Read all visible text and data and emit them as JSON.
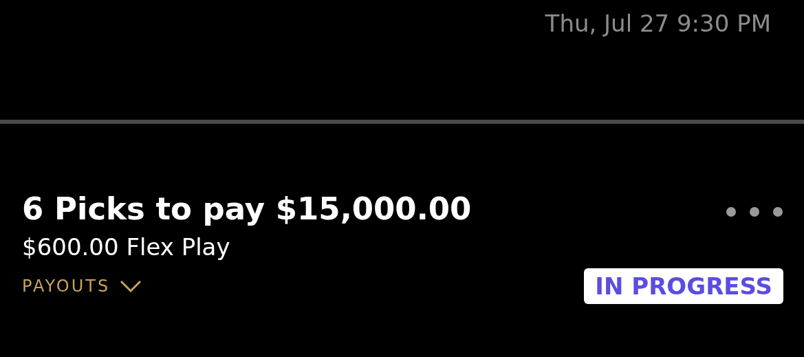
{
  "header": {
    "date": "Thu, Jul 27 9:30 PM"
  },
  "entry": {
    "title": "6 Picks to pay $15,000.00",
    "subtitle": "$600.00 Flex Play",
    "payouts": {
      "label": "PAYOUTS",
      "expanded": false
    },
    "status": {
      "kind": "in_progress",
      "label": "IN PROGRESS"
    }
  }
}
